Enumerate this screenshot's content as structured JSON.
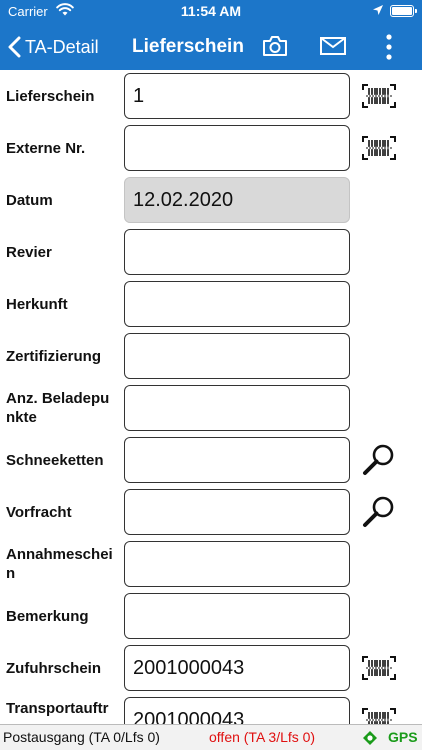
{
  "status_bar": {
    "carrier": "Carrier",
    "time": "11:54 AM"
  },
  "nav": {
    "back_label": "TA-Detail",
    "title": "Lieferschein",
    "icons": [
      "camera-icon",
      "mail-icon",
      "more-vertical-icon"
    ]
  },
  "form": {
    "rows": [
      {
        "label": "Lieferschein",
        "value": "1",
        "icon": "barcode-icon"
      },
      {
        "label": "Externe Nr.",
        "value": "",
        "icon": "barcode-icon"
      },
      {
        "label": "Datum",
        "value": "12.02.2020",
        "disabled": true
      },
      {
        "label": "Revier",
        "value": ""
      },
      {
        "label": "Herkunft",
        "value": ""
      },
      {
        "label": "Zertifizierung",
        "value": ""
      },
      {
        "label": "Anz. Beladepunkte",
        "value": ""
      },
      {
        "label": "Schneeketten",
        "value": "",
        "icon": "search-icon"
      },
      {
        "label": "Vorfracht",
        "value": "",
        "icon": "search-icon"
      },
      {
        "label": "Annahmeschein",
        "value": ""
      },
      {
        "label": "Bemerkung",
        "value": ""
      },
      {
        "label": "Zufuhrschein",
        "value": "2001000043",
        "icon": "barcode-icon"
      },
      {
        "label": "Transportauftr",
        "value": "2001000043",
        "icon": "barcode-icon"
      }
    ]
  },
  "bottom_bar": {
    "postausgang": "Postausgang (TA 0/Lfs 0)",
    "offen": "offen (TA 3/Lfs 0)",
    "gps": "GPS",
    "colors": {
      "offen": "#e01010",
      "gps": "#1a9b1a"
    }
  },
  "colors": {
    "brand": "#1c76c9"
  }
}
